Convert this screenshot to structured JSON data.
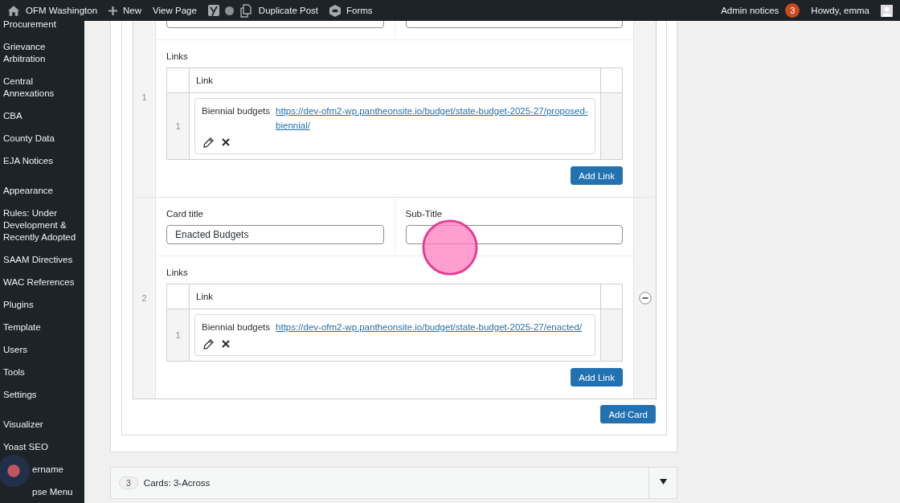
{
  "admin_bar": {
    "site": "OFM Washington",
    "new": "New",
    "view": "View Page",
    "duplicate": "Duplicate Post",
    "forms": "Forms",
    "notices": "Admin notices",
    "notice_count": "3",
    "greeting": "Howdy, emma"
  },
  "sidebar": {
    "groups": [
      [
        "Procurement",
        "Grievance Arbitration",
        "Central Annexations",
        "CBA",
        "County Data",
        "EJA Notices"
      ],
      [
        "Appearance",
        "Rules: Under Development & Recently Adopted",
        "SAAM Directives",
        "WAC References",
        "Plugins",
        "Template",
        "Users",
        "Tools",
        "Settings"
      ],
      [
        "Visualizer",
        "Yoast SEO"
      ]
    ],
    "partly_covered_items": [
      "ername",
      "pse Menu"
    ]
  },
  "cards": [
    {
      "index": "1",
      "remove_visible": false,
      "links_label": "Links",
      "link_header": "Link",
      "links": [
        {
          "index": "1",
          "label": "Biennial budgets",
          "url": "https://dev-ofm2-wp.pantheonsite.io/budget/state-budget-2025-27/proposed-biennial/"
        }
      ],
      "add_link": "Add Link"
    },
    {
      "index": "2",
      "card_title_label": "Card title",
      "card_title_value": "Enacted Budgets",
      "subtitle_label": "Sub-Title",
      "remove_visible": true,
      "links_label": "Links",
      "link_header": "Link",
      "links": [
        {
          "index": "1",
          "label": "Biennial budgets",
          "url": "https://dev-ofm2-wp.pantheonsite.io/budget/state-budget-2025-27/enacted/"
        }
      ],
      "add_link": "Add Link"
    }
  ],
  "add_card": "Add Card",
  "collapsed_block": {
    "index": "3",
    "title": "Cards: 3-Across"
  }
}
